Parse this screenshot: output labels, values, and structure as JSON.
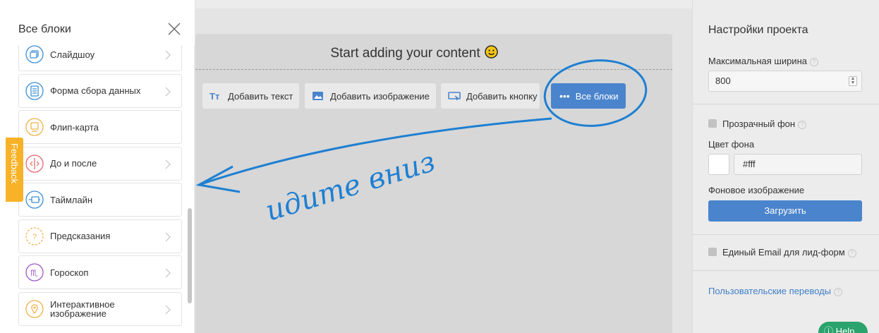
{
  "drawer": {
    "title": "Все блоки",
    "items": [
      {
        "label": "Слайдшоу",
        "icon": "slideshow-icon",
        "color": "#3d8fd6"
      },
      {
        "label": "Форма сбора данных",
        "icon": "form-icon",
        "color": "#3d8fd6"
      },
      {
        "label": "Флип-карта",
        "icon": "flip-card-icon",
        "color": "#f2b04a"
      },
      {
        "label": "До и после",
        "icon": "before-after-icon",
        "color": "#e56a6a"
      },
      {
        "label": "Таймлайн",
        "icon": "timeline-icon",
        "color": "#3d8fd6"
      },
      {
        "label": "Предсказания",
        "icon": "prediction-icon",
        "color": "#f2b04a"
      },
      {
        "label": "Гороскоп",
        "icon": "horoscope-icon",
        "color": "#9a5bc9"
      },
      {
        "label": "Интерактивное\nизображение",
        "icon": "interactive-image-icon",
        "color": "#f2b04a"
      }
    ]
  },
  "feedback": {
    "label": "Feedback"
  },
  "canvas": {
    "title": "Start adding your content",
    "toolbar": {
      "add_text": "Добавить текст",
      "add_image": "Добавить изображение",
      "add_button": "Добавить кнопку",
      "all_blocks": "Все блоки"
    },
    "annotation_text": "идите вниз"
  },
  "settings": {
    "title": "Настройки проекта",
    "max_width_label": "Максимальная ширина",
    "max_width_value": "800",
    "transparent_bg_label": "Прозрачный фон",
    "bg_color_label": "Цвет фона",
    "bg_color_value": "#fff",
    "bg_image_label": "Фоновое изображение",
    "upload_label": "Загрузить",
    "single_email_label": "Единый Email для лид-форм",
    "custom_translations_label": "Пользовательские переводы",
    "help_label": "Help"
  },
  "colors": {
    "accent": "#4a84cc",
    "annotation": "#1e7fd2",
    "feedback": "#f7b228"
  }
}
